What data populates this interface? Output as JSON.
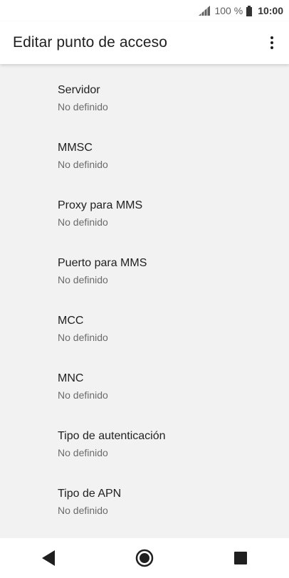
{
  "status_bar": {
    "battery_percent": "100 %",
    "time": "10:00"
  },
  "app_bar": {
    "title": "Editar punto de acceso"
  },
  "settings": [
    {
      "title": "Servidor",
      "summary": "No definido"
    },
    {
      "title": "MMSC",
      "summary": "No definido"
    },
    {
      "title": "Proxy para MMS",
      "summary": "No definido"
    },
    {
      "title": "Puerto para MMS",
      "summary": "No definido"
    },
    {
      "title": "MCC",
      "summary": "No definido"
    },
    {
      "title": "MNC",
      "summary": "No definido"
    },
    {
      "title": "Tipo de autenticación",
      "summary": "No definido"
    },
    {
      "title": "Tipo de APN",
      "summary": "No definido"
    }
  ],
  "icons": {
    "signal": "signal-icon",
    "battery": "battery-icon",
    "overflow": "more-vert-icon",
    "back": "back-triangle-icon",
    "home": "home-circle-icon",
    "recents": "recents-square-icon"
  },
  "colors": {
    "background": "#f2f2f2",
    "bar": "#ffffff",
    "text_primary": "#212121",
    "text_secondary": "#6b6b6b"
  }
}
